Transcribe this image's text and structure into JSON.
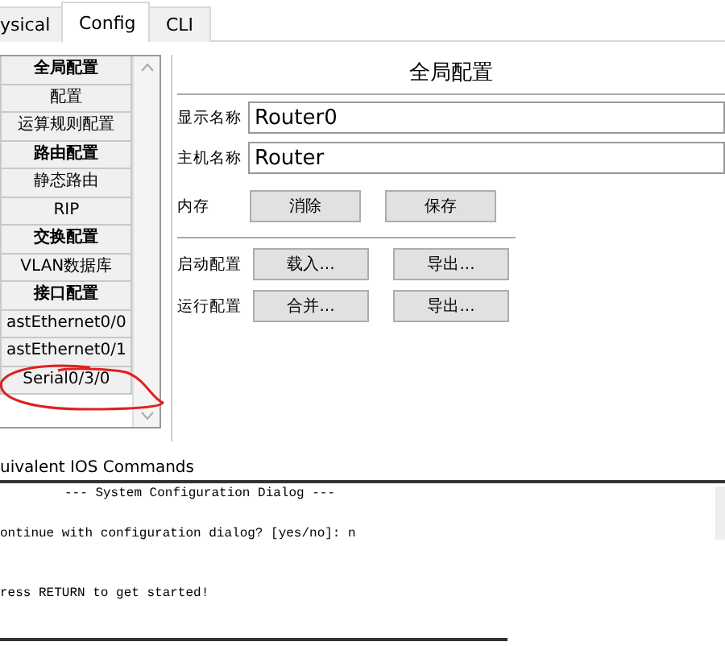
{
  "tabs": [
    {
      "label": "ysical",
      "selected": false
    },
    {
      "label": "Config",
      "selected": true
    },
    {
      "label": "CLI",
      "selected": false
    }
  ],
  "sidebar": {
    "items": [
      {
        "label": "全局配置",
        "kind": "heading",
        "selected": false
      },
      {
        "label": "配置",
        "kind": "item",
        "selected": false
      },
      {
        "label": "运算规则配置",
        "kind": "item",
        "selected": false
      },
      {
        "label": "路由配置",
        "kind": "heading",
        "selected": false
      },
      {
        "label": "静态路由",
        "kind": "item",
        "selected": false
      },
      {
        "label": "RIP",
        "kind": "item",
        "selected": false
      },
      {
        "label": "交换配置",
        "kind": "heading",
        "selected": false
      },
      {
        "label": "VLAN数据库",
        "kind": "item",
        "selected": false
      },
      {
        "label": "接口配置",
        "kind": "heading",
        "selected": false
      },
      {
        "label": "astEthernet0/0",
        "kind": "item",
        "selected": false
      },
      {
        "label": "astEthernet0/1",
        "kind": "item",
        "selected": false
      },
      {
        "label": "Serial0/3/0",
        "kind": "item",
        "selected": false
      }
    ]
  },
  "panel": {
    "title": "全局配置",
    "fields": [
      {
        "label": "显示名称",
        "value": "Router0"
      },
      {
        "label": "主机名称",
        "value": "Router"
      }
    ],
    "rows": [
      {
        "label": "内存",
        "buttons": [
          "消除",
          "保存"
        ],
        "divider_after": true
      },
      {
        "label": "启动配置",
        "buttons": [
          "载入...",
          "导出..."
        ],
        "divider_after": false
      },
      {
        "label": "运行配置",
        "buttons": [
          "合并...",
          "导出..."
        ],
        "divider_after": false
      }
    ]
  },
  "console": {
    "heading": "uivalent IOS Commands",
    "lines": [
      "--- System Configuration Dialog ---",
      "ontinue with configuration dialog? [yes/no]: n",
      "ress RETURN to get started!"
    ]
  }
}
